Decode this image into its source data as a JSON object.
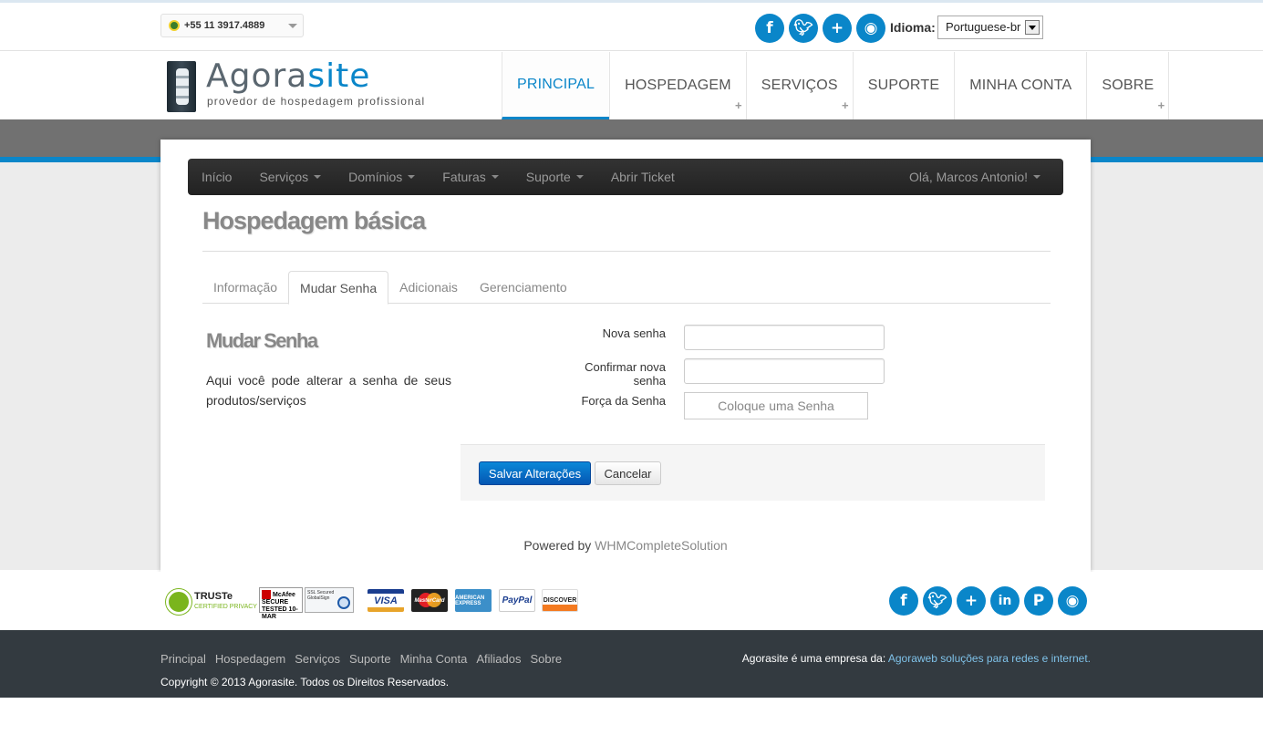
{
  "topbar": {
    "phone": "+55 11 3917.4889",
    "social_icons": [
      "facebook-icon",
      "twitter-icon",
      "plus-icon",
      "rss-icon"
    ],
    "language_label": "Idioma:",
    "language_value": "Portuguese-br"
  },
  "brand": {
    "name_part1": "Agora",
    "name_part2": "site",
    "tagline": "provedor de hospedagem profissional",
    "accent_color": "#0a86c9"
  },
  "main_nav": [
    {
      "label": "PRINCIPAL",
      "active": true
    },
    {
      "label": "HOSPEDAGEM",
      "has_plus": true
    },
    {
      "label": "SERVIÇOS",
      "has_plus": true
    },
    {
      "label": "SUPORTE"
    },
    {
      "label": "MINHA CONTA"
    },
    {
      "label": "SOBRE",
      "has_plus": true
    }
  ],
  "sub_nav": {
    "items": [
      "Início",
      "Serviços",
      "Domínios",
      "Faturas",
      "Suporte",
      "Abrir Ticket"
    ],
    "user": "Olá, Marcos Antonio!"
  },
  "page": {
    "title": "Hospedagem básica",
    "tabs": [
      "Informação",
      "Mudar Senha",
      "Adicionais",
      "Gerenciamento"
    ],
    "active_tab": "Mudar Senha"
  },
  "form": {
    "section_title": "Mudar Senha",
    "description": "Aqui você pode alterar a senha de seus produtos/serviços",
    "new_password_label": "Nova senha",
    "new_password_value": "",
    "confirm_label": "Confirmar nova senha",
    "confirm_value": "",
    "strength_label": "Força da Senha",
    "strength_text": "Coloque uma Senha",
    "save_label": "Salvar Alterações",
    "cancel_label": "Cancelar"
  },
  "powered": {
    "prefix": "Powered by",
    "link": "WHMCompleteSolution"
  },
  "badges": {
    "truste": "TRUSTe",
    "truste_sub": "CERTIFIED PRIVACY",
    "mcafee": "McAfee SECURE",
    "mcafee_sub": "TESTED 10-MAR",
    "ssl": "SSL Secured GlobalSign",
    "cards": [
      "VISA",
      "MasterCard",
      "AMERICAN EXPRESS",
      "PayPal",
      "DISCOVER"
    ]
  },
  "social_bottom": [
    "facebook-icon",
    "twitter-icon",
    "plus-icon",
    "linkedin-icon",
    "pinterest-icon",
    "rss-icon"
  ],
  "footer": {
    "links": [
      "Principal",
      "Hospedagem",
      "Serviços",
      "Suporte",
      "Minha Conta",
      "Afiliados",
      "Sobre"
    ],
    "copyright": "Copyright © 2013 Agorasite. Todos os Direitos Reservados.",
    "company_prefix": "Agorasite é uma empresa da:",
    "company_link": "Agoraweb soluções para redes e internet."
  }
}
